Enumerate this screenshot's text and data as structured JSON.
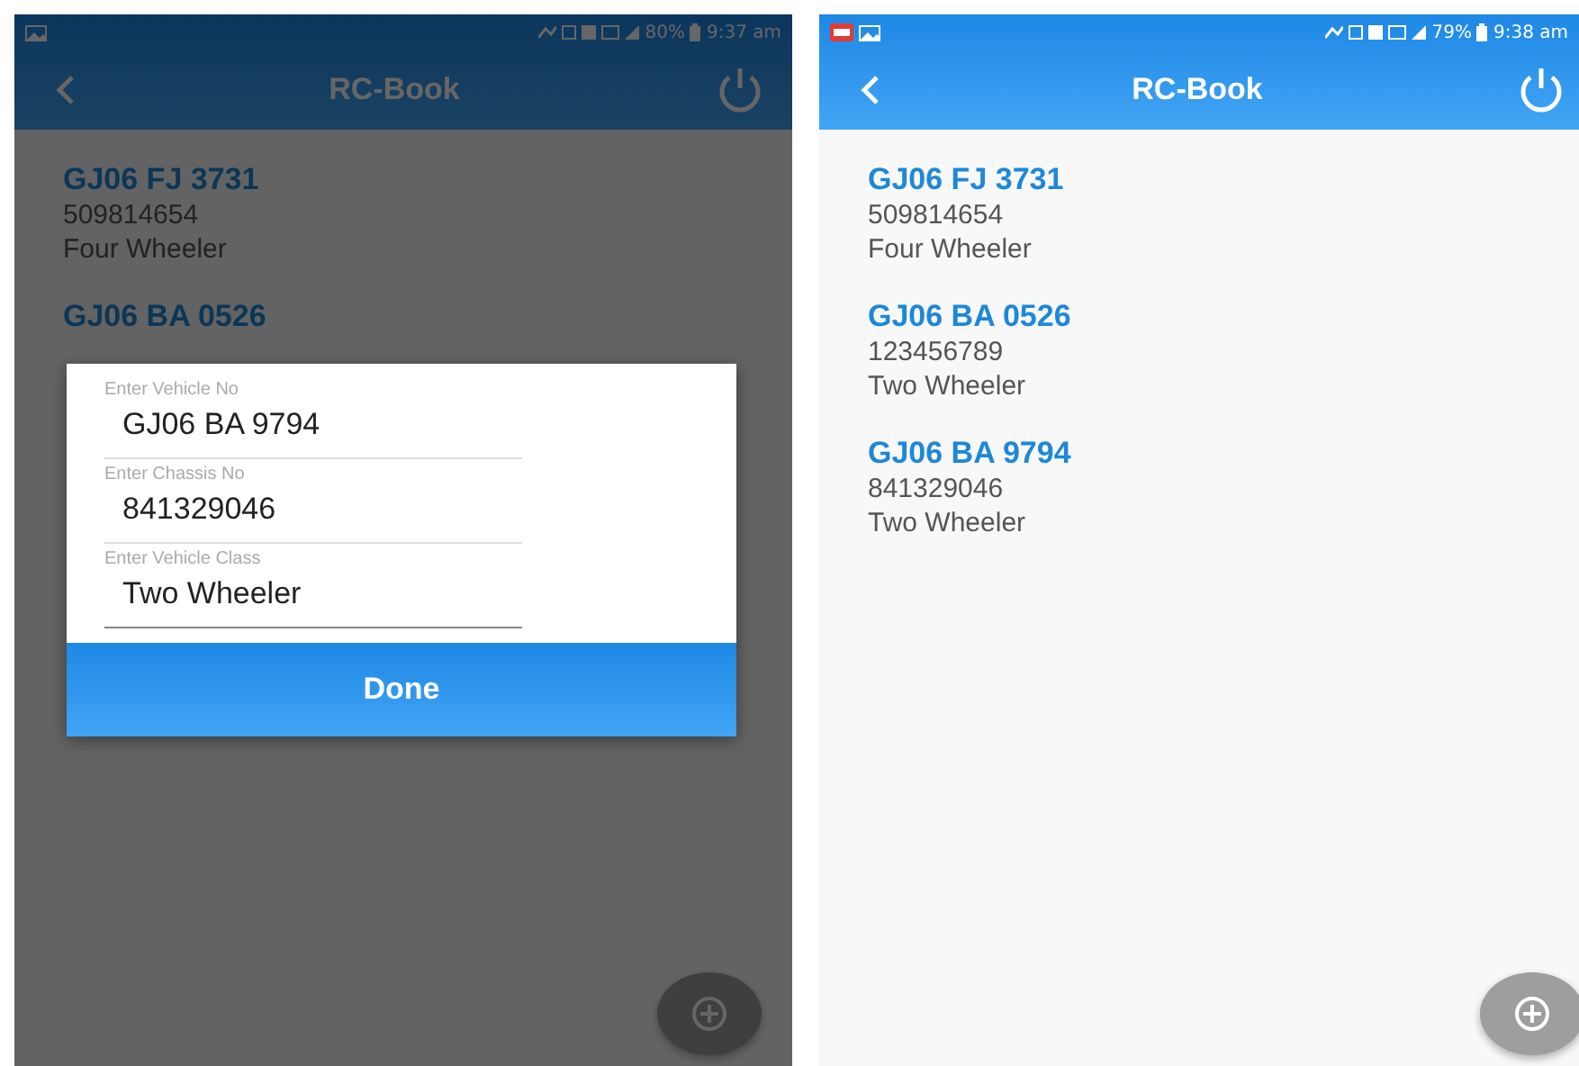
{
  "screens": [
    {
      "dimmed": true,
      "status_bar": {
        "extra_app_icon": false,
        "battery": "80%",
        "time": "9:37 am"
      },
      "app_bar": {
        "title": "RC-Book"
      },
      "vehicles": [
        {
          "number": "GJ06 FJ 3731",
          "chassis": "509814654",
          "class": "Four Wheeler"
        },
        {
          "number": "GJ06 BA 0526"
        }
      ],
      "dialog": {
        "fields": [
          {
            "placeholder": "Enter Vehicle No",
            "value": "GJ06 BA 9794"
          },
          {
            "placeholder": "Enter Chassis No",
            "value": "841329046"
          },
          {
            "placeholder": "Enter Vehicle Class",
            "value": "Two Wheeler"
          }
        ],
        "button": "Done"
      }
    },
    {
      "dimmed": false,
      "status_bar": {
        "extra_app_icon": true,
        "battery": "79%",
        "time": "9:38 am"
      },
      "app_bar": {
        "title": "RC-Book"
      },
      "vehicles": [
        {
          "number": "GJ06 FJ 3731",
          "chassis": "509814654",
          "class": "Four Wheeler"
        },
        {
          "number": "GJ06 BA 0526",
          "chassis": "123456789",
          "class": "Two Wheeler"
        },
        {
          "number": "GJ06 BA 9794",
          "chassis": "841329046",
          "class": "Two Wheeler"
        }
      ]
    }
  ]
}
